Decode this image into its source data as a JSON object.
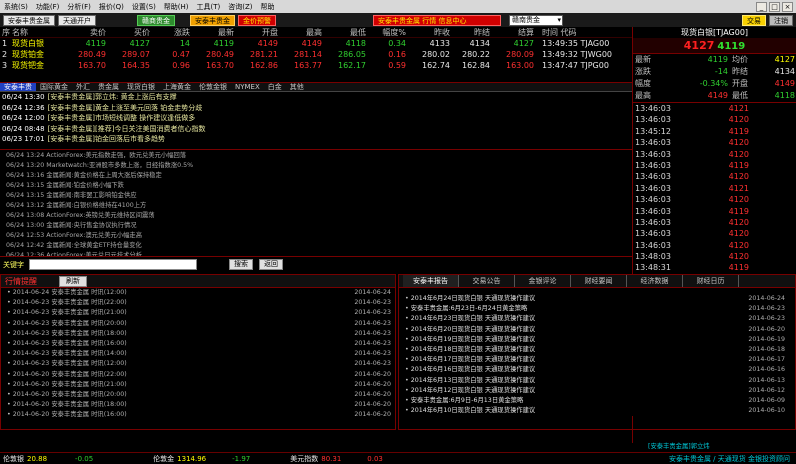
{
  "menubar": {
    "items": [
      "系统(S)",
      "功能(F)",
      "分析(F)",
      "报价(Q)",
      "设置(S)",
      "帮助(H)",
      "工具(T)",
      "咨询(Z)",
      "帮助"
    ],
    "sys_buttons": [
      "_",
      "□",
      "×"
    ]
  },
  "toolbar": {
    "account": "安泰丰贵金属",
    "open_account": "天通开户",
    "btn_green": "赣商贵金",
    "btn_orange": "安泰丰贵金",
    "btn_red": "金价预警",
    "btn_ticker": "安泰丰贵金属 行情 信息中心",
    "select_value": "赣南贵金",
    "btn_trade": "交易",
    "btn_login": "注销"
  },
  "quote_table": {
    "headers": [
      "序",
      "名称",
      "卖价",
      "买价",
      "涨跌",
      "最新",
      "开盘",
      "最高",
      "最低",
      "幅度%",
      "昨收",
      "昨结",
      "结算",
      "时间 代码"
    ],
    "rows": [
      {
        "no": "1",
        "name": "现货白银",
        "sell": "4119",
        "buy": "4127",
        "change": "14",
        "last": "4119",
        "open": "4149",
        "high": "4149",
        "low": "4118",
        "pct": "0.34",
        "prev_close": "4133",
        "prev_settle": "4134",
        "settle": "4127",
        "time_code": "13:49:35 TJAG00"
      },
      {
        "no": "2",
        "name": "现货铂金",
        "sell": "280.49",
        "buy": "289.07",
        "change": "0.47",
        "last": "280.49",
        "open": "281.21",
        "high": "281.14",
        "low": "286.05",
        "pct": "0.16",
        "prev_close": "280.02",
        "prev_settle": "280.22",
        "settle": "280.09",
        "time_code": "13:49:32 TJWG00"
      },
      {
        "no": "3",
        "name": "现货钯金",
        "sell": "163.70",
        "buy": "164.35",
        "change": "0.96",
        "last": "163.70",
        "open": "162.86",
        "high": "163.77",
        "low": "162.17",
        "pct": "0.59",
        "prev_close": "162.74",
        "prev_settle": "162.84",
        "settle": "163.00",
        "time_code": "13:47:47 TJPG00"
      }
    ]
  },
  "right_panel": {
    "title": "现货白银[TJAG00]",
    "price_main": "4127",
    "price_sub": "4119",
    "stats": [
      {
        "l1": "最新",
        "v1": "4119",
        "l2": "均价",
        "v2": "4127"
      },
      {
        "l1": "涨跌",
        "v1": "-14",
        "l2": "昨结",
        "v2": "4134"
      },
      {
        "l1": "幅度",
        "v1": "-0.34%",
        "l2": "开盘",
        "v2": "4149"
      },
      {
        "l1": "最高",
        "v1": "4149",
        "l2": "最低",
        "v2": "4118"
      }
    ],
    "ticks": [
      {
        "t": "13:46:03",
        "p": "4121"
      },
      {
        "t": "13:46:03",
        "p": "4120"
      },
      {
        "t": "13:45:12",
        "p": "4119"
      },
      {
        "t": "13:46:03",
        "p": "4120"
      },
      {
        "t": "13:46:03",
        "p": "4120"
      },
      {
        "t": "13:46:03",
        "p": "4119"
      },
      {
        "t": "13:46:03",
        "p": "4120"
      },
      {
        "t": "13:46:03",
        "p": "4121"
      },
      {
        "t": "13:46:03",
        "p": "4120"
      },
      {
        "t": "13:46:03",
        "p": "4119"
      },
      {
        "t": "13:46:03",
        "p": "4120"
      },
      {
        "t": "13:46:03",
        "p": "4120"
      },
      {
        "t": "13:46:03",
        "p": "4120"
      },
      {
        "t": "13:48:03",
        "p": "4120"
      },
      {
        "t": "13:48:31",
        "p": "4119"
      },
      {
        "t": "13:48:52",
        "p": "4120"
      },
      {
        "t": "13:49:03",
        "p": "4121"
      },
      {
        "t": "13:49:03",
        "p": "4120"
      },
      {
        "t": "13:49:19",
        "p": "4119"
      }
    ]
  },
  "news_tabs": [
    "安泰丰贵",
    "国际黄金",
    "外汇",
    "贵金属",
    "现货白银",
    "上海黄金",
    "伦敦金银",
    "NYMEX",
    "白金",
    "其他"
  ],
  "headlines": [
    {
      "time": "06/24 13:30",
      "text": "[安泰丰贵金属]郭立炜: 黄金上涨后有支撑"
    },
    {
      "time": "06/24 12:36",
      "text": "[安泰丰贵金属]黄金上涨至美元回落 铂金走势分歧"
    },
    {
      "time": "06/24 12:00",
      "text": "[安泰丰贵金属]市场短线调整 操作建议逢低做多"
    },
    {
      "time": "06/24 08:48",
      "text": "[安泰丰贵金属][推荐]今日关注美国消费者信心指数"
    },
    {
      "time": "06/23 17:01",
      "text": "[安泰丰贵金属]铂金回落后市看多趋势"
    }
  ],
  "news_feed": [
    "06/24 13:24 ActionForex:美元指数走强，欧元兑美元小幅回落",
    "06/24 13:20 Marketwatch:亚洲股市多数上涨，日经指数涨0.5%",
    "06/24 13:16 金属新闻:黄金价格在上周大涨后保持稳定",
    "06/24 13:15 金属新闻:铂金价格小幅下跌",
    "06/24 13:15 金属新闻:南非罢工影响铂金供应",
    "06/24 13:12 金属新闻:白银价格维持在4100上方",
    "06/24 13:08 ActionForex:英镑兑美元维持区间震荡",
    "06/24 13:00 金属新闻:央行售金协议执行情况",
    "06/24 12:53 ActionForex:澳元兑美元小幅走高",
    "06/24 12:42 金属新闻:全球黄金ETF持仓量变化",
    "06/24 12:36 ActionForex:美元兑日元技术分析",
    "06/24 12:30 金属新闻:贵金属市场周评"
  ],
  "search": {
    "label": "关键字",
    "button": "搜索",
    "button2": "返回"
  },
  "bottom_left": {
    "title": "行情提醒",
    "refresh": "刷新",
    "rows": [
      {
        "text": "2014-06-24 安泰丰贵金属 时讯(12:00)",
        "date": "2014-06-24"
      },
      {
        "text": "2014-06-23 安泰丰贵金属 时讯(22:00)",
        "date": "2014-06-23"
      },
      {
        "text": "2014-06-23 安泰丰贵金属 时讯(21:00)",
        "date": "2014-06-23"
      },
      {
        "text": "2014-06-23 安泰丰贵金属 时讯(20:00)",
        "date": "2014-06-23"
      },
      {
        "text": "2014-06-23 安泰丰贵金属 时讯(18:00)",
        "date": "2014-06-23"
      },
      {
        "text": "2014-06-23 安泰丰贵金属 时讯(16:00)",
        "date": "2014-06-23"
      },
      {
        "text": "2014-06-23 安泰丰贵金属 时讯(14:00)",
        "date": "2014-06-23"
      },
      {
        "text": "2014-06-23 安泰丰贵金属 时讯(12:00)",
        "date": "2014-06-23"
      },
      {
        "text": "2014-06-20 安泰丰贵金属 时讯(22:00)",
        "date": "2014-06-20"
      },
      {
        "text": "2014-06-20 安泰丰贵金属 时讯(21:00)",
        "date": "2014-06-20"
      },
      {
        "text": "2014-06-20 安泰丰贵金属 时讯(20:00)",
        "date": "2014-06-20"
      },
      {
        "text": "2014-06-20 安泰丰贵金属 时讯(18:00)",
        "date": "2014-06-20"
      },
      {
        "text": "2014-06-20 安泰丰贵金属 时讯(16:00)",
        "date": "2014-06-20"
      }
    ]
  },
  "bottom_right": {
    "tabs": [
      "安泰丰报告",
      "交易公告",
      "金银评论",
      "财经要闻",
      "经济数据",
      "财经日历"
    ],
    "rows": [
      {
        "text": "2014年6月24日现货白银 天通现货操作建议",
        "date": "2014-06-24"
      },
      {
        "text": "安泰丰贵金属:6月23日-6月24日黄金策略",
        "date": "2014-06-23"
      },
      {
        "text": "2014年6月23日现货白银 天通现货操作建议",
        "date": "2014-06-23"
      },
      {
        "text": "2014年6月20日现货白银 天通现货操作建议",
        "date": "2014-06-20"
      },
      {
        "text": "2014年6月19日现货白银 天通现货操作建议",
        "date": "2014-06-19"
      },
      {
        "text": "2014年6月18日现货白银 天通现货操作建议",
        "date": "2014-06-18"
      },
      {
        "text": "2014年6月17日现货白银 天通现货操作建议",
        "date": "2014-06-17"
      },
      {
        "text": "2014年6月16日现货白银 天通现货操作建议",
        "date": "2014-06-16"
      },
      {
        "text": "2014年6月13日现货白银 天通现货操作建议",
        "date": "2014-06-13"
      },
      {
        "text": "2014年6月12日现货白银 天通现货操作建议",
        "date": "2014-06-12"
      },
      {
        "text": "安泰丰贵金属:6月9日-6月13日黄金策略",
        "date": "2014-06-09"
      },
      {
        "text": "2014年6月10日现货白银 天通现货操作建议",
        "date": "2014-06-10"
      }
    ]
  },
  "status_bar": {
    "items": [
      {
        "label": "伦敦银",
        "value": "20.88",
        "change": "-0.05"
      },
      {
        "label": "伦敦金",
        "value": "1314.96",
        "change": "-1.97"
      },
      {
        "label": "美元指数",
        "value": "80.31",
        "change": "0.03"
      }
    ],
    "ticker": "安泰丰贵金属 / 天通现货 金银投资顾问"
  },
  "bottom_ticker": "[安泰丰贵金属]郭立炜"
}
